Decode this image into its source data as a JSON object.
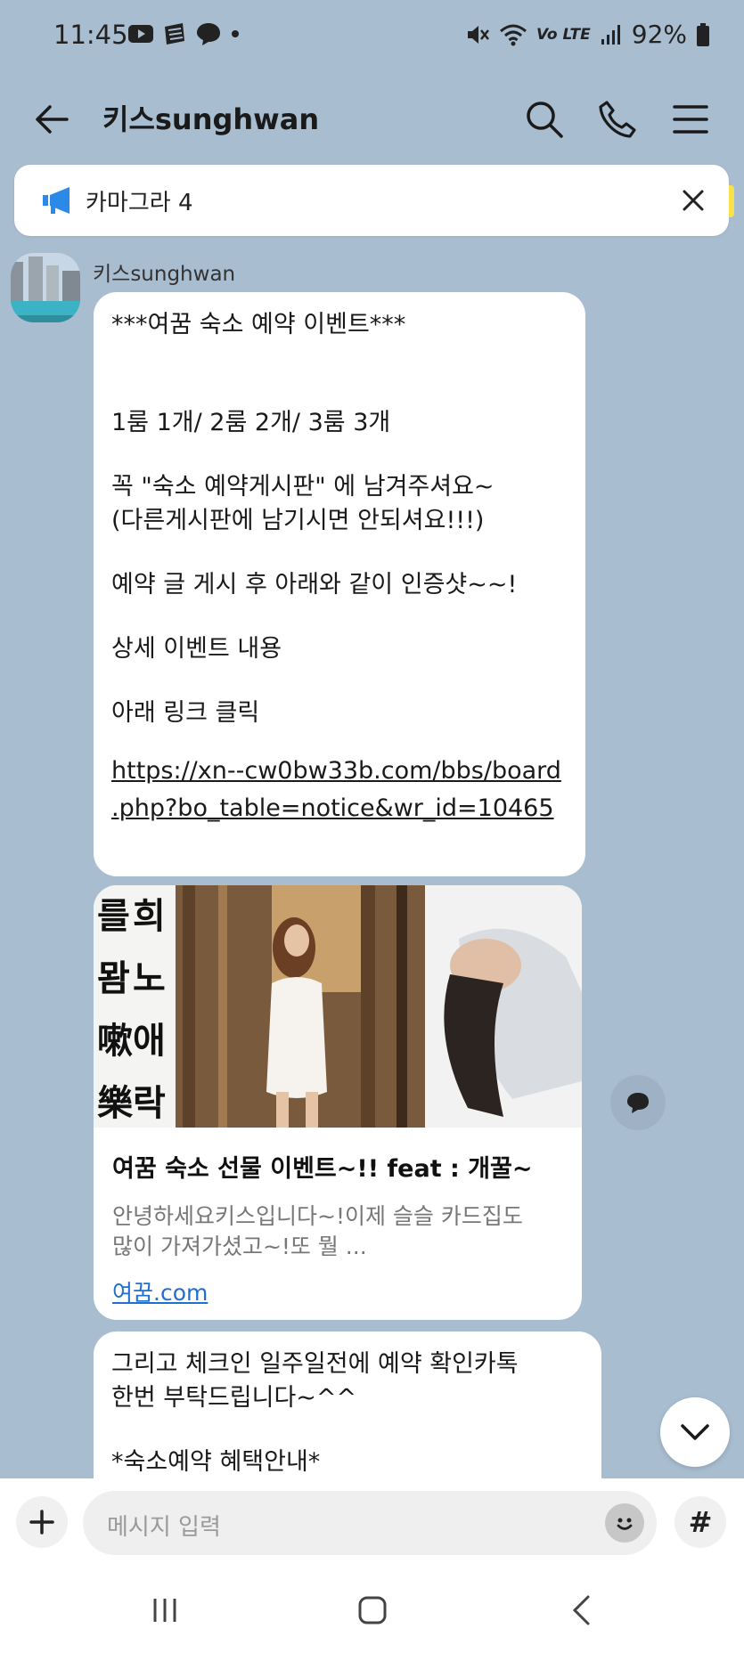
{
  "status_bar": {
    "time": "11:45",
    "battery": "92%",
    "network": "Vo LTE",
    "notification_icons": [
      "youtube-icon",
      "app-icon",
      "messenger-icon",
      "dot-icon"
    ]
  },
  "header": {
    "title": "키스sunghwan"
  },
  "notice": {
    "text": "카마그라 4"
  },
  "message": {
    "sender": "키스sunghwan",
    "bubble1": {
      "line1": "***여꿈 숙소 예약 이벤트***",
      "line2": "1룸 1개/ 2룸 2개/ 3룸 3개",
      "line3": "꼭  \"숙소 예약게시판\" 에 남겨주셔요~",
      "line4": "(다른게시판에 남기시면 안되셔요!!!)",
      "line5": "예약 글 게시 후 아래와 같이 인증샷~~!",
      "line6": "상세 이벤트 내용",
      "line7": "아래 링크 클릭",
      "link_line1": "https://xn--cw0bw33b.com/bbs/board",
      "link_line2": ".php?bo_table=notice&wr_id=10465"
    },
    "card": {
      "title": "여꿈 숙소 선물 이벤트~!! feat : 개꿀~",
      "desc_line1": "안녕하세요키스입니다~!이제 슬슬 카드집도",
      "desc_line2": "많이 가져가셨고~!또 뭘 ...",
      "url": "여꿈.com",
      "image_text": [
        "희",
        "노",
        "애",
        "락"
      ]
    },
    "bubble2": {
      "line1": "그리고 체크인 일주일전에 예약 확인카톡",
      "line2": "한번 부탁드립니다~^^",
      "line3": "*숙소예약 혜택안내*"
    }
  },
  "input": {
    "placeholder": "메시지 입력",
    "hash": "#"
  },
  "colors": {
    "background": "#a9bdd1",
    "bubble": "#ffffff",
    "link": "#1e6fd0",
    "notice_accent": "#2b8ae8"
  }
}
